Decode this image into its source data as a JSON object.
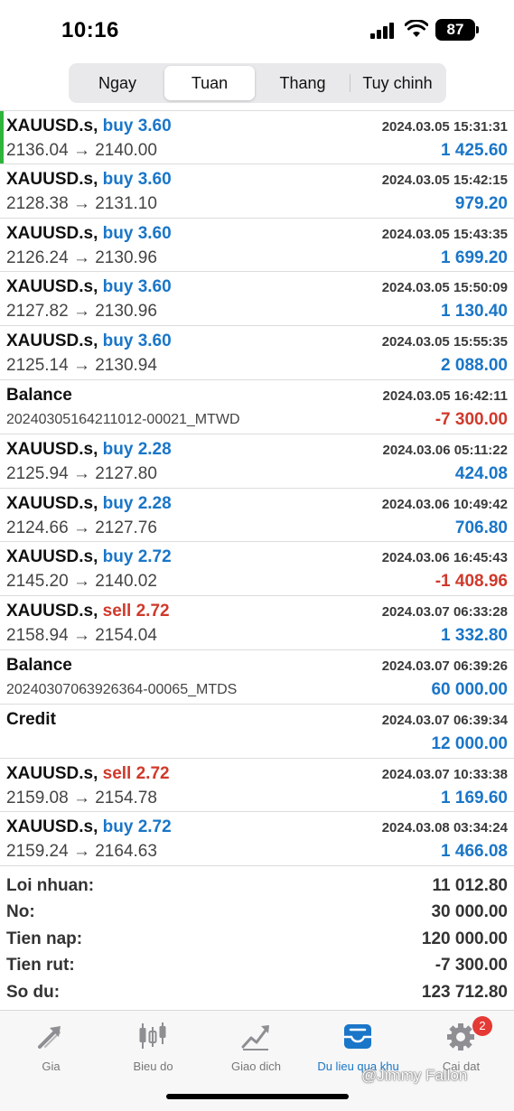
{
  "status_bar": {
    "time": "10:16",
    "battery": "87"
  },
  "tabs_period": [
    {
      "label": "Ngay",
      "active": false
    },
    {
      "label": "Tuan",
      "active": true
    },
    {
      "label": "Thang",
      "active": false
    },
    {
      "label": "Tuy chinh",
      "active": false
    }
  ],
  "rows": [
    {
      "symbol": "XAUUSD.s,",
      "direction": "buy 3.60",
      "date": "2024.03.05 15:31:31",
      "prices": "2136.04 → 2140.00",
      "value": "1 425.60"
    },
    {
      "symbol": "XAUUSD.s,",
      "direction": "buy 3.60",
      "date": "2024.03.05 15:42:15",
      "prices": "2128.38 → 2131.10",
      "value": "979.20"
    },
    {
      "symbol": "XAUUSD.s,",
      "direction": "buy 3.60",
      "date": "2024.03.05 15:43:35",
      "prices": "2126.24 → 2130.96",
      "value": "1 699.20"
    },
    {
      "symbol": "XAUUSD.s,",
      "direction": "buy 3.60",
      "date": "2024.03.05 15:50:09",
      "prices": "2127.82 → 2130.96",
      "value": "1 130.40"
    },
    {
      "symbol": "XAUUSD.s,",
      "direction": "buy 3.60",
      "date": "2024.03.05 15:55:35",
      "prices": "2125.14 → 2130.94",
      "value": "2 088.00"
    },
    {
      "symbol": "Balance",
      "direction": "",
      "date": "2024.03.05 16:42:11",
      "prices": "20240305164211012-00021_MTWD",
      "value": "-7 300.00"
    },
    {
      "symbol": "XAUUSD.s,",
      "direction": "buy 2.28",
      "date": "2024.03.06 05:11:22",
      "prices": "2125.94 → 2127.80",
      "value": "424.08"
    },
    {
      "symbol": "XAUUSD.s,",
      "direction": "buy 2.28",
      "date": "2024.03.06 10:49:42",
      "prices": "2124.66 → 2127.76",
      "value": "706.80"
    },
    {
      "symbol": "XAUUSD.s,",
      "direction": "buy 2.72",
      "date": "2024.03.06 16:45:43",
      "prices": "2145.20 → 2140.02",
      "value": "-1 408.96"
    },
    {
      "symbol": "XAUUSD.s,",
      "direction": "sell 2.72",
      "date": "2024.03.07 06:33:28",
      "prices": "2158.94 → 2154.04",
      "value": "1 332.80"
    },
    {
      "symbol": "Balance",
      "direction": "",
      "date": "2024.03.07 06:39:26",
      "prices": "20240307063926364-00065_MTDS",
      "value": "60 000.00"
    },
    {
      "symbol": "Credit",
      "direction": "",
      "date": "2024.03.07 06:39:34",
      "prices": "",
      "value": "12 000.00"
    },
    {
      "symbol": "XAUUSD.s,",
      "direction": "sell 2.72",
      "date": "2024.03.07 10:33:38",
      "prices": "2159.08 → 2154.78",
      "value": "1 169.60"
    },
    {
      "symbol": "XAUUSD.s,",
      "direction": "buy 2.72",
      "date": "2024.03.08 03:34:24",
      "prices": "2159.24 → 2164.63",
      "value": "1 466.08"
    }
  ],
  "summary": [
    {
      "label": "Loi nhuan:",
      "value": "11 012.80"
    },
    {
      "label": "No:",
      "value": "30 000.00"
    },
    {
      "label": "Tien nap:",
      "value": "120 000.00"
    },
    {
      "label": "Tien rut:",
      "value": "-7 300.00"
    },
    {
      "label": "So du:",
      "value": "123 712.80"
    }
  ],
  "bottom_tabs": [
    {
      "label": "Gia",
      "icon": "arrows-icon"
    },
    {
      "label": "Bieu do",
      "icon": "candlestick-icon"
    },
    {
      "label": "Giao dich",
      "icon": "trade-chart-icon"
    },
    {
      "label": "Du lieu qua khu",
      "icon": "history-inbox-icon"
    },
    {
      "label": "Cai dat",
      "icon": "gear-icon",
      "badge": "2"
    }
  ],
  "watermark": "@Jimmy Fallon",
  "colors": {
    "buy": "#1a76c8",
    "sell": "#d0392b",
    "accent": "#1a76c8",
    "highlight": "#2fb43a"
  }
}
